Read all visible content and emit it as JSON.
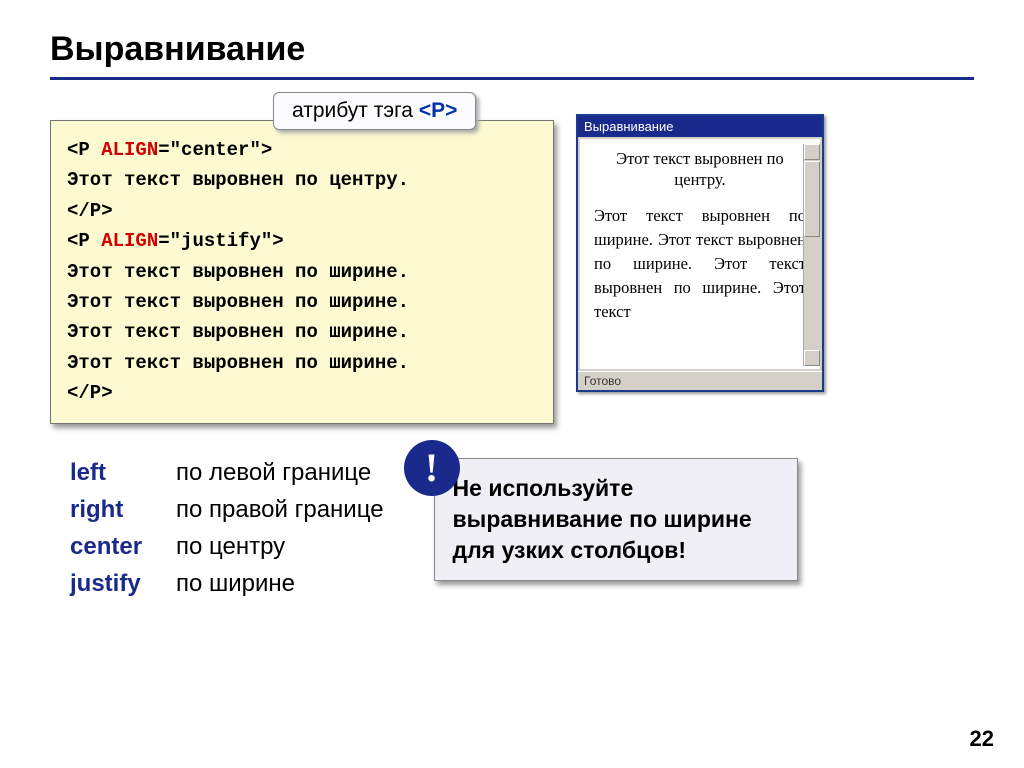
{
  "title": "Выравнивание",
  "attrib": {
    "prefix": "атрибут тэга ",
    "tag": "<P>"
  },
  "code": {
    "l1a": "<P ",
    "l1b": "ALIGN",
    "l1c": "=\"center\">",
    "l2": "Этот текст выровнен по центру.",
    "l3": "</P>",
    "l4a": "<P ",
    "l4b": "ALIGN",
    "l4c": "=\"justify\">",
    "l5": "Этот текст выровнен по ширине.",
    "l6": "Этот текст выровнен по ширине.",
    "l7": "Этот текст выровнен по ширине.",
    "l8": "Этот текст выровнен по ширине.",
    "l9": "</P>"
  },
  "browser": {
    "title": "Выравнивание",
    "centered": "Этот текст выровнен по центру.",
    "just": "Этот текст выровнен по ширине. Этот текст выровнен по ширине. Этот текст выровнен по ширине. Этот текст",
    "status": "Готово"
  },
  "aligns": {
    "left_kw": "left",
    "left_desc": "по левой границе",
    "right_kw": "right",
    "right_desc": "по правой границе",
    "center_kw": "center",
    "center_desc": "по центру",
    "justify_kw": "justify",
    "justify_desc": "по ширине"
  },
  "warn": {
    "bang": "!",
    "text": "Не используйте выравнивание по ширине для узких столбцов!"
  },
  "pagenum": "22"
}
